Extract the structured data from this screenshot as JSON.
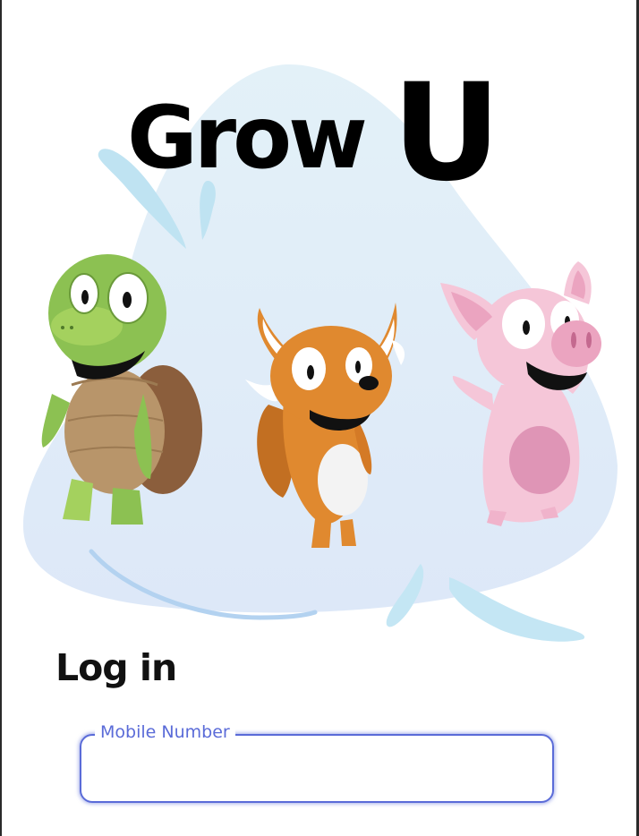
{
  "brand": {
    "name_part1": "Grow",
    "name_part2": "U"
  },
  "illustration": {
    "characters": [
      "turtle",
      "fox",
      "pig"
    ],
    "background": "water-splash"
  },
  "login": {
    "title": "Log in",
    "mobile_field": {
      "label": "Mobile Number",
      "value": ""
    }
  },
  "colors": {
    "accent": "#5a6bd8",
    "splash": "#dfeaf7",
    "turtle_green": "#8cc152",
    "fox_orange": "#e0892f",
    "pig_pink": "#f5c6d8"
  }
}
